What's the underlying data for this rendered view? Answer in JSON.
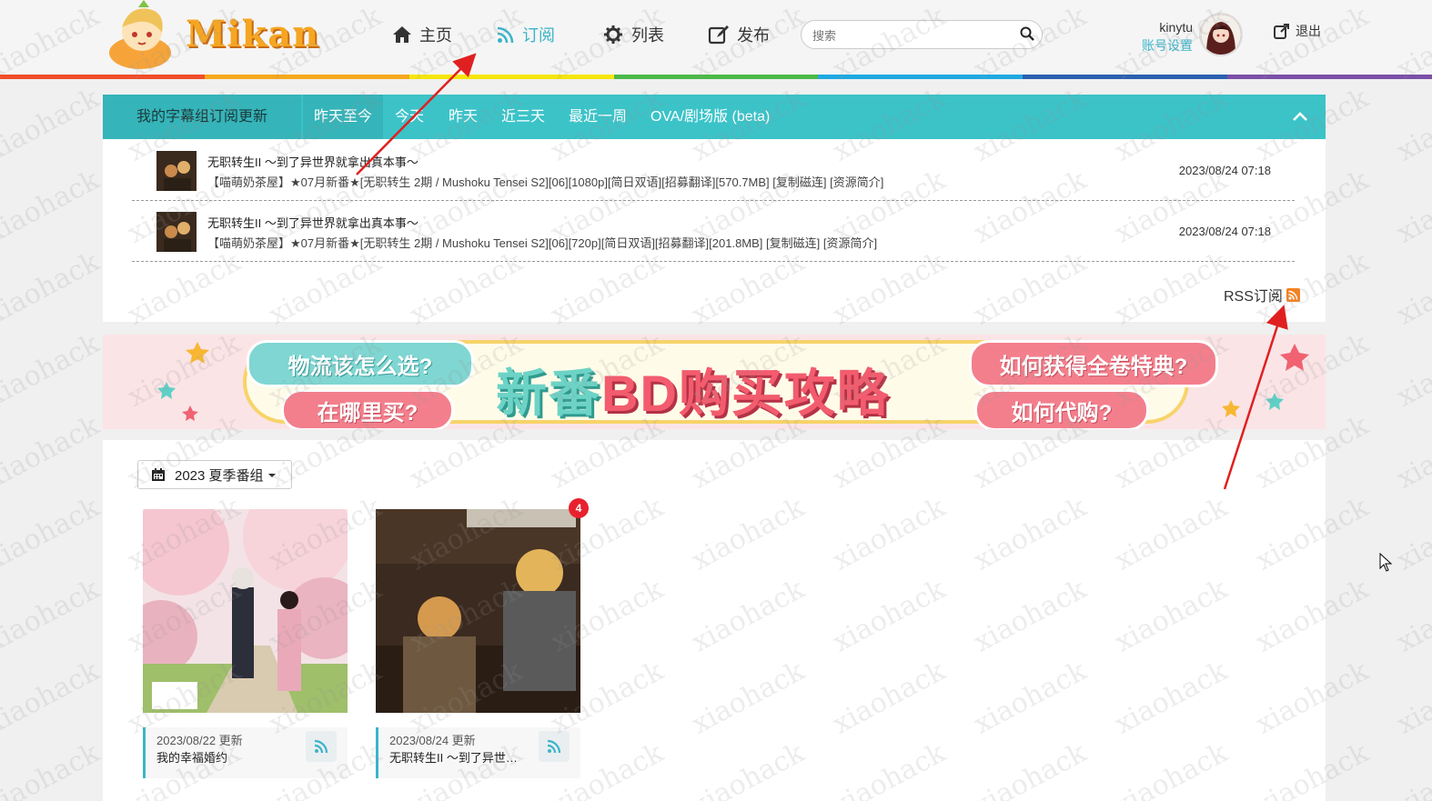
{
  "header": {
    "logo_text": "Mikan",
    "nav": [
      {
        "label": "主页",
        "icon": "home-icon",
        "active": false
      },
      {
        "label": "订阅",
        "icon": "rss-icon",
        "active": true
      },
      {
        "label": "列表",
        "icon": "puzzle-icon",
        "active": false
      },
      {
        "label": "发布",
        "icon": "edit-icon",
        "active": false
      }
    ],
    "search_placeholder": "搜索",
    "user": {
      "name": "kinytu",
      "settings_label": "账号设置"
    },
    "logout_label": "退出"
  },
  "subscriptions": {
    "title": "我的字幕组订阅更新",
    "tabs": [
      "昨天至今",
      "今天",
      "昨天",
      "近三天",
      "最近一周",
      "OVA/剧场版 (beta)"
    ],
    "active_tab": "昨天至今",
    "rows": [
      {
        "title": "无职转生II ～到了异世界就拿出真本事～",
        "desc": "【喵萌奶茶屋】★07月新番★[无职转生 2期 / Mushoku Tensei S2][06][1080p][简日双语][招募翻译][570.7MB] [复制磁连] [资源简介]",
        "date": "2023/08/24 07:18"
      },
      {
        "title": "无职转生II ～到了异世界就拿出真本事～",
        "desc": "【喵萌奶茶屋】★07月新番★[无职转生 2期 / Mushoku Tensei S2][06][720p][简日双语][招募翻译][201.8MB] [复制磁连] [资源简介]",
        "date": "2023/08/24 07:18"
      }
    ],
    "rss_label": "RSS订阅"
  },
  "banner": {
    "left_top": "物流该怎么选?",
    "left_bottom": "在哪里买?",
    "main_a": "新番",
    "main_b": "BD购买攻略",
    "right_top": "如何获得全卷特典?",
    "right_bottom": "如何代购?"
  },
  "season": {
    "selector_label": "2023 夏季番组",
    "cards": [
      {
        "date": "2023/08/22 更新",
        "name": "我的幸福婚约",
        "badge": ""
      },
      {
        "date": "2023/08/24 更新",
        "name": "无职转生II ～到了异世界就拿出真本事～",
        "badge": "4"
      }
    ]
  },
  "watermark": "xiaohack",
  "colors": {
    "accent": "#3bc3c8",
    "rainbow": [
      "#f04e2a",
      "#f7a81b",
      "#f5e50a",
      "#4cb848",
      "#1fa9e1",
      "#2b60b0",
      "#7b4fa8"
    ]
  }
}
